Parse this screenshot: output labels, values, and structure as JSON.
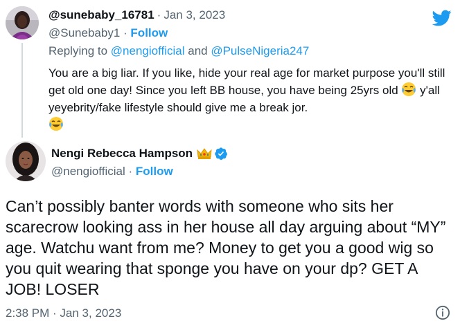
{
  "reply": {
    "display_name": "@sunebaby_16781",
    "separator": "·",
    "date": "Jan 3, 2023",
    "handle": "@Sunebaby1",
    "dot": "·",
    "follow_label": "Follow",
    "replying_prefix": "Replying to ",
    "mention_1": "@nengiofficial",
    "and_word": " and ",
    "mention_2": "@PulseNigeria247",
    "text_part1": "You are a big liar. If you like, hide your real age for market purpose you'll still get old one day! Since you left BB house, you have being 25yrs old ",
    "text_part2": " y'all yeyebrity/fake lifestyle should give me a break jor.",
    "emoji_name": "face-with-tears-of-joy-emoji"
  },
  "main": {
    "display_name": "Nengi Rebecca Hampson",
    "crown_icon": "crown-icon",
    "verified_icon": "verified-badge-icon",
    "handle": "@nengiofficial",
    "dot": "·",
    "follow_label": "Follow",
    "text": "Can’t possibly banter words with someone who sits her scarecrow looking ass in her house all day arguing about “MY” age. Watchu want from me? Money to get you a good wig so you quit wearing that sponge you have on your dp? GET A JOB! LOSER",
    "timestamp": "2:38 PM · Jan 3, 2023"
  },
  "colors": {
    "accent": "#1d9bf0",
    "secondary_text": "#536471",
    "primary_text": "#0f1419",
    "thread_line": "#cfd9de"
  }
}
